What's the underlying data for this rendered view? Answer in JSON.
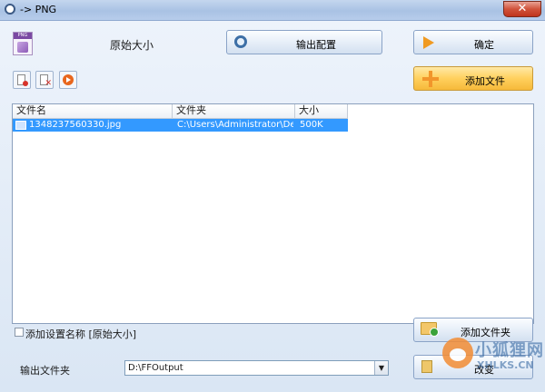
{
  "window": {
    "title": "-> PNG",
    "close_label": "✕"
  },
  "preset": {
    "name": "原始大小"
  },
  "buttons": {
    "output_config": "输出配置",
    "ok": "确定",
    "add_file": "添加文件",
    "add_folder": "添加文件夹",
    "change": "改变"
  },
  "file_list": {
    "columns": [
      "文件名",
      "文件夹",
      "大小"
    ],
    "rows": [
      {
        "name": "1348237560330.jpg",
        "folder": "C:\\Users\\Administrator\\Des...",
        "size": "500K"
      }
    ]
  },
  "options": {
    "add_setting_name": "添加设置名称 [原始大小]",
    "add_setting_name_checked": false
  },
  "output": {
    "label": "输出文件夹",
    "path": "D:\\FFOutput"
  },
  "watermark": {
    "cn": "小狐狸网",
    "en": "XHLKS.CN"
  },
  "colors": {
    "selection": "#3399ff",
    "accent_orange": "#f6b93a"
  }
}
